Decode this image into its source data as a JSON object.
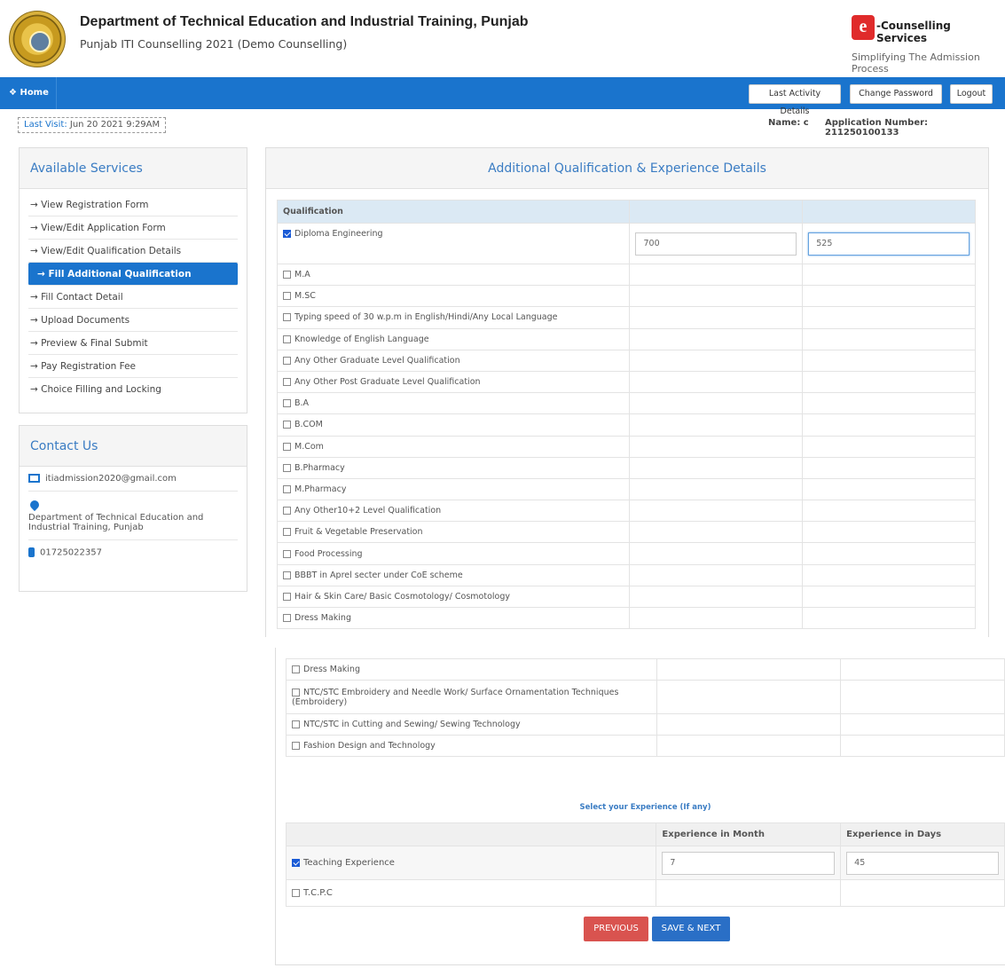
{
  "header": {
    "title": "Department of Technical Education and Industrial Training, Punjab",
    "subtitle": "Punjab ITI Counselling 2021 (Demo Counselling)",
    "brand_icon": "e",
    "brand_name": "-Counselling Services",
    "brand_tagline": "Simplifying The Admission Process"
  },
  "navbar": {
    "home": "❖ Home",
    "last_activity": "Last Activity Details",
    "change_password": "Change Password",
    "logout": "Logout"
  },
  "session": {
    "last_visit_label": "Last Visit:",
    "last_visit_value": "Jun 20 2021 9:29AM",
    "name": "Name: c",
    "application_number": "Application Number: 211250100133"
  },
  "sidebar": {
    "services_title": "Available Services",
    "items": [
      {
        "label": "→ View Registration Form"
      },
      {
        "label": "→ View/Edit Application Form"
      },
      {
        "label": "→ View/Edit Qualification Details"
      },
      {
        "label": "→ Fill Additional Qualification"
      },
      {
        "label": "→ Fill Contact Detail"
      },
      {
        "label": "→ Upload Documents"
      },
      {
        "label": "→ Preview & Final Submit"
      },
      {
        "label": "→ Pay Registration Fee"
      },
      {
        "label": "→ Choice Filling and Locking"
      }
    ],
    "contact_title": "Contact Us",
    "email": "itiadmission2020@gmail.com",
    "address": "Department of Technical Education and Industrial Training, Punjab",
    "phone": "01725022357"
  },
  "main": {
    "title": "Additional Qualification & Experience Details",
    "qual_header": "Qualification",
    "qualifications": [
      {
        "label": "Diploma Engineering",
        "checked": true,
        "v1": "700",
        "v2": "525"
      },
      {
        "label": "M.A"
      },
      {
        "label": "M.SC"
      },
      {
        "label": "Typing speed of 30 w.p.m in English/Hindi/Any Local Language"
      },
      {
        "label": "Knowledge of English Language"
      },
      {
        "label": "Any Other Graduate Level Qualification"
      },
      {
        "label": "Any Other Post Graduate Level Qualification"
      },
      {
        "label": "B.A"
      },
      {
        "label": "B.COM"
      },
      {
        "label": "M.Com"
      },
      {
        "label": "B.Pharmacy"
      },
      {
        "label": "M.Pharmacy"
      },
      {
        "label": "Any Other10+2 Level Qualification"
      },
      {
        "label": "Fruit & Vegetable Preservation"
      },
      {
        "label": "Food Processing"
      },
      {
        "label": "BBBT in Aprel secter under CoE scheme"
      },
      {
        "label": "Hair & Skin Care/ Basic Cosmotology/ Cosmotology"
      },
      {
        "label": "Dress Making"
      }
    ],
    "qualifications_continued": [
      {
        "label": "Dress Making"
      },
      {
        "label": "NTC/STC Embroidery and Needle Work/ Surface Ornamentation Techniques (Embroidery)"
      },
      {
        "label": "NTC/STC in Cutting and Sewing/ Sewing Technology"
      },
      {
        "label": "Fashion Design and Technology"
      }
    ],
    "experience": {
      "title": "Select your Experience (If any)",
      "col_month": "Experience in Month",
      "col_days": "Experience in Days",
      "rows": [
        {
          "label": "Teaching Experience",
          "checked": true,
          "months": "7",
          "days": "45"
        },
        {
          "label": "T.C.P.C"
        }
      ]
    },
    "buttons": {
      "previous": "PREVIOUS",
      "save_next": "SAVE & NEXT"
    }
  }
}
